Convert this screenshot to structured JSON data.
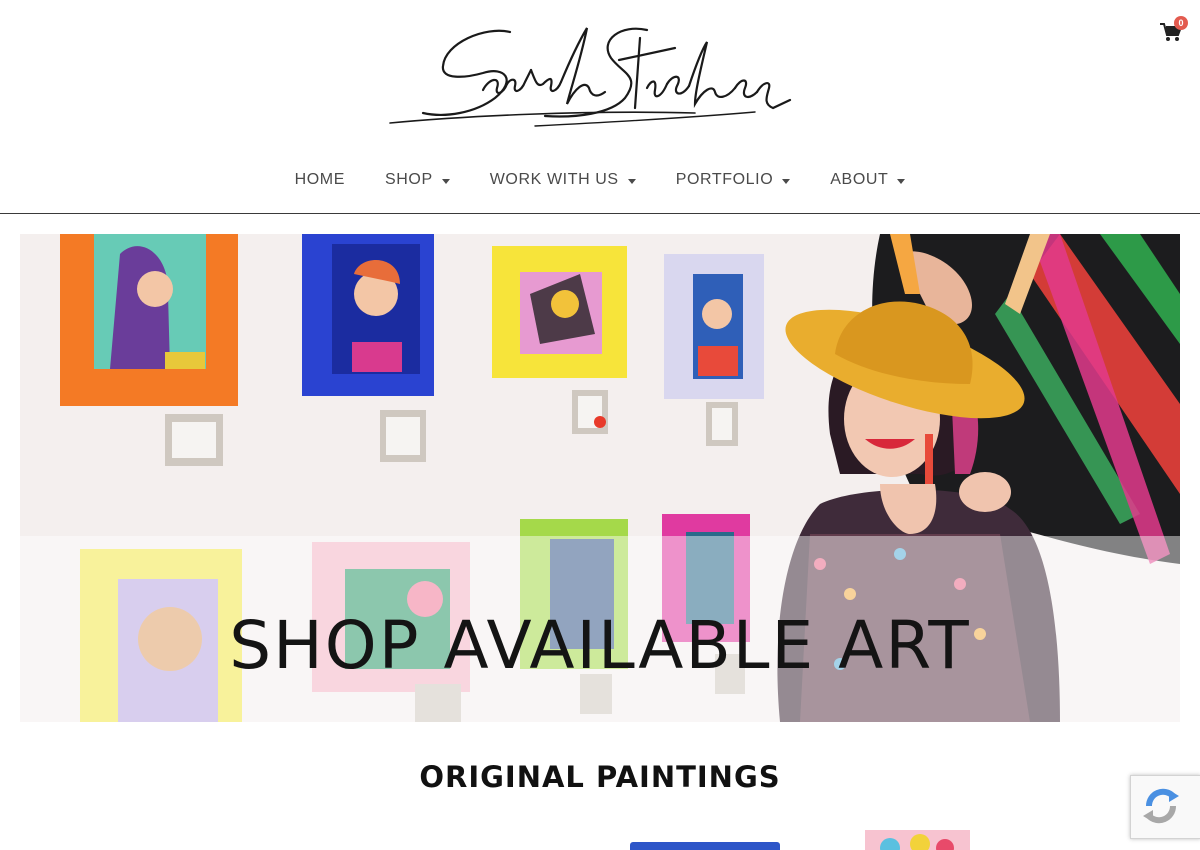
{
  "brand": {
    "logo_text": "Sarah Stieber"
  },
  "cart": {
    "count": "0",
    "icon": "cart-icon"
  },
  "nav": {
    "items": [
      {
        "label": "HOME",
        "dropdown": false
      },
      {
        "label": "SHOP",
        "dropdown": true
      },
      {
        "label": "WORK WITH US",
        "dropdown": true
      },
      {
        "label": "PORTFOLIO",
        "dropdown": true
      },
      {
        "label": "ABOUT",
        "dropdown": true
      }
    ]
  },
  "hero": {
    "title": "SHOP AVAILABLE ART"
  },
  "section": {
    "title": "ORIGINAL PAINTINGS"
  },
  "colors": {
    "text": "#4a4a4a",
    "badge": "#e35b4f",
    "divider": "#3a3a3a"
  }
}
